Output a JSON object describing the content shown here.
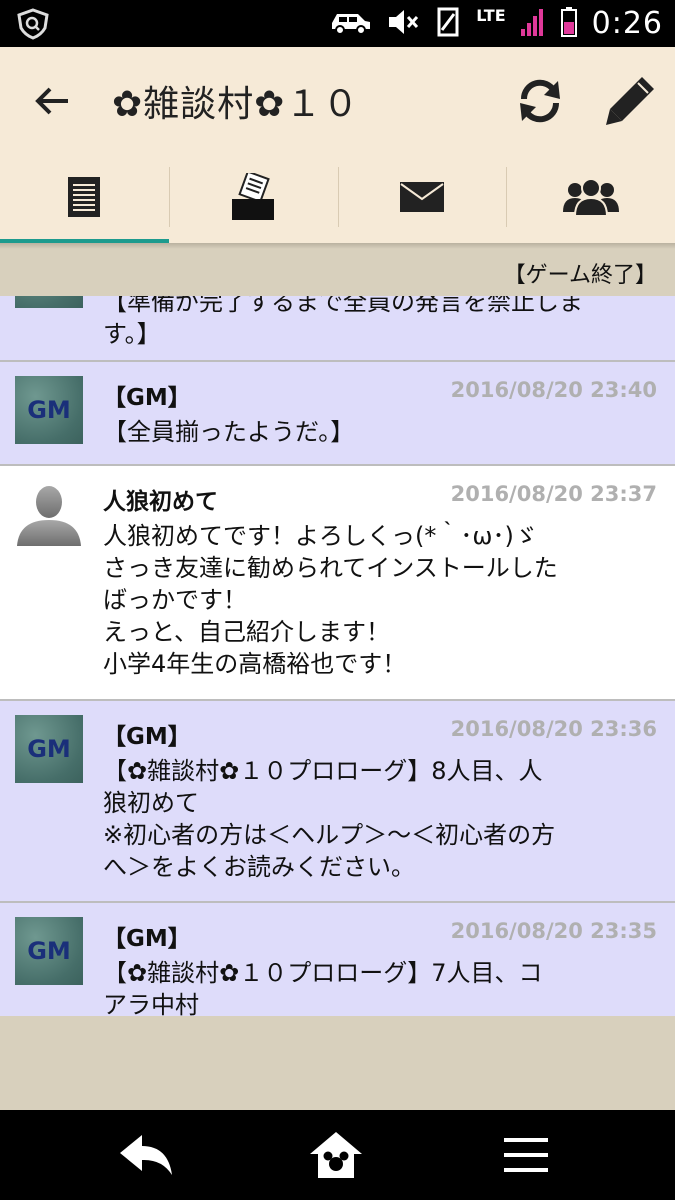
{
  "status_bar": {
    "time": "0:26",
    "network": "LTE",
    "icons": [
      "shield-search-icon",
      "car-icon",
      "mute-icon",
      "vibrate-icon",
      "signal-icon",
      "battery-icon"
    ]
  },
  "app_bar": {
    "title": "✿雑談村✿１０",
    "icons": [
      "back-arrow-icon",
      "refresh-icon",
      "pencil-icon"
    ]
  },
  "tabs": [
    {
      "icon": "list-icon",
      "active": true
    },
    {
      "icon": "ballot-box-icon",
      "active": false
    },
    {
      "icon": "envelope-icon",
      "active": false
    },
    {
      "icon": "group-icon",
      "active": false
    }
  ],
  "game_status": "【ゲーム終了】",
  "messages": [
    {
      "type": "gm",
      "partial_body": "【準備が完了するまで全員の発言を禁止しま\nす。】"
    },
    {
      "type": "gm",
      "avatar_text": "GM",
      "name": "【GM】",
      "time": "2016/08/20 23:40",
      "body": "【全員揃ったようだ。】"
    },
    {
      "type": "player",
      "name": "人狼初めて",
      "time": "2016/08/20 23:37",
      "body": "人狼初めてです！よろしくっ(*｀･ω･)ゞ\nさっき友達に勧められてインストールした\nばっかです！\nえっと、自己紹介します！\n小学4年生の高橋裕也です！"
    },
    {
      "type": "gm",
      "avatar_text": "GM",
      "name": "【GM】",
      "time": "2016/08/20 23:36",
      "body": "【✿雑談村✿１０プロローグ】8人目、人\n狼初めて\n※初心者の方は＜ヘルプ＞～＜初心者の方\nへ＞をよくお読みください。"
    },
    {
      "type": "gm",
      "avatar_text": "GM",
      "name": "【GM】",
      "time": "2016/08/20 23:35",
      "body": "【✿雑談村✿１０プロローグ】7人目、コ\nアラ中村"
    }
  ],
  "nav_bar": {
    "icons": [
      "back-nav-icon",
      "home-nav-icon",
      "menu-nav-icon"
    ]
  },
  "colors": {
    "app_bar_bg": "#f6ead7",
    "gm_message_bg": "#dedcfa",
    "player_message_bg": "#ffffff",
    "tab_indicator": "#1d9b8e",
    "timestamp": "#b0b0b0",
    "background": "#d8d0bd"
  }
}
